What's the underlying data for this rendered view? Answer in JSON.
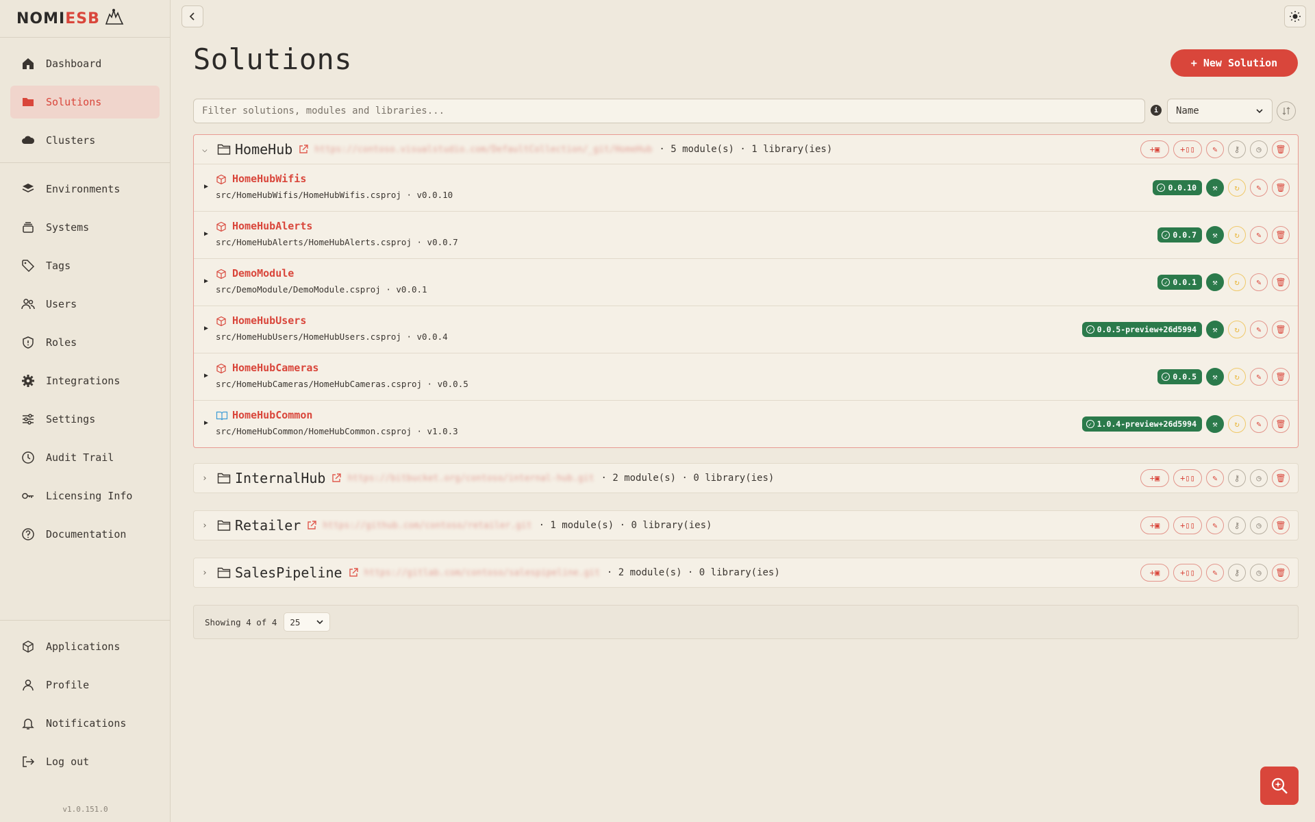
{
  "brand": {
    "logo_part1": "NOMI",
    "logo_part2": "ESB"
  },
  "sidebar": {
    "items": [
      {
        "label": "Dashboard",
        "icon": "home-icon"
      },
      {
        "label": "Solutions",
        "icon": "folder-icon"
      },
      {
        "label": "Clusters",
        "icon": "cloud-icon"
      },
      {
        "label": "Environments",
        "icon": "layers-icon"
      },
      {
        "label": "Systems",
        "icon": "stack-icon"
      },
      {
        "label": "Tags",
        "icon": "tag-icon"
      },
      {
        "label": "Users",
        "icon": "users-icon"
      },
      {
        "label": "Roles",
        "icon": "shield-icon"
      },
      {
        "label": "Integrations",
        "icon": "gear-icon"
      },
      {
        "label": "Settings",
        "icon": "sliders-icon"
      },
      {
        "label": "Audit Trail",
        "icon": "clock-icon"
      },
      {
        "label": "Licensing Info",
        "icon": "key-icon"
      },
      {
        "label": "Documentation",
        "icon": "help-icon"
      }
    ],
    "bottom_items": [
      {
        "label": "Applications",
        "icon": "box-icon"
      },
      {
        "label": "Profile",
        "icon": "user-icon"
      },
      {
        "label": "Notifications",
        "icon": "bell-icon"
      },
      {
        "label": "Log out",
        "icon": "logout-icon"
      }
    ],
    "version": "v1.0.151.0"
  },
  "main": {
    "title": "Solutions",
    "new_button": "+ New Solution",
    "filter_placeholder": "Filter solutions, modules and libraries...",
    "sort_value": "Name",
    "solutions": [
      {
        "name": "HomeHub",
        "url": "https://contoso.visualstudio.com/DefaultCollection/_git/HomeHub",
        "meta": "· 5 module(s) · 1 library(ies)",
        "expanded": true,
        "modules": [
          {
            "name": "HomeHubWifis",
            "path": "src/HomeHubWifis/HomeHubWifis.csproj ·  v0.0.10",
            "badge": "0.0.10",
            "kind": "module"
          },
          {
            "name": "HomeHubAlerts",
            "path": "src/HomeHubAlerts/HomeHubAlerts.csproj ·  v0.0.7",
            "badge": "0.0.7",
            "kind": "module"
          },
          {
            "name": "DemoModule",
            "path": "src/DemoModule/DemoModule.csproj ·  v0.0.1",
            "badge": "0.0.1",
            "kind": "module"
          },
          {
            "name": "HomeHubUsers",
            "path": "src/HomeHubUsers/HomeHubUsers.csproj ·  v0.0.4",
            "badge": "0.0.5-preview+26d5994",
            "kind": "module"
          },
          {
            "name": "HomeHubCameras",
            "path": "src/HomeHubCameras/HomeHubCameras.csproj ·  v0.0.5",
            "badge": "0.0.5",
            "kind": "module"
          },
          {
            "name": "HomeHubCommon",
            "path": "src/HomeHubCommon/HomeHubCommon.csproj ·  v1.0.3",
            "badge": "1.0.4-preview+26d5994",
            "kind": "library"
          }
        ]
      },
      {
        "name": "InternalHub",
        "url": "https://bitbucket.org/contoso/internal-hub.git",
        "meta": "· 2 module(s) · 0 library(ies)",
        "expanded": false
      },
      {
        "name": "Retailer",
        "url": "https://github.com/contoso/retailer.git",
        "meta": "· 1 module(s) · 0 library(ies)",
        "expanded": false
      },
      {
        "name": "SalesPipeline",
        "url": "https://gitlab.com/contoso/salespipeline.git",
        "meta": "· 2 module(s) · 0 library(ies)",
        "expanded": false
      }
    ],
    "footer": {
      "showing": "Showing 4 of 4",
      "page_size": "25"
    }
  },
  "colors": {
    "accent": "#d9463b",
    "success": "#2b7a4b",
    "background": "#efe9dd"
  }
}
